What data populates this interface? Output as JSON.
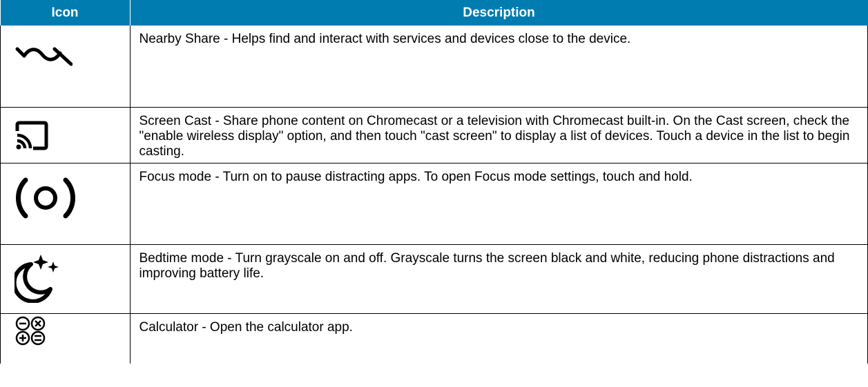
{
  "table": {
    "headers": {
      "icon": "Icon",
      "description": "Description"
    },
    "rows": [
      {
        "icon": "nearby-share-icon",
        "description": "Nearby Share - Helps find and interact with services and devices close to the device."
      },
      {
        "icon": "screen-cast-icon",
        "description": "Screen Cast - Share phone content on Chromecast or a television with Chromecast built-in. On the Cast screen, check the \"enable wireless display\" option, and then touch \"cast screen\" to display a list of devices. Touch a device in the list to begin casting."
      },
      {
        "icon": "focus-mode-icon",
        "description": "Focus mode - Turn on to pause distracting apps. To open Focus mode settings, touch and hold."
      },
      {
        "icon": "bedtime-mode-icon",
        "description": "Bedtime mode - Turn grayscale on and off. Grayscale turns the screen black and white, reducing phone distractions and improving battery life."
      },
      {
        "icon": "calculator-icon",
        "description": "Calculator - Open the calculator app."
      }
    ]
  },
  "colors": {
    "header_background": "#007cb0",
    "header_text": "#ffffff",
    "border": "#000000"
  }
}
